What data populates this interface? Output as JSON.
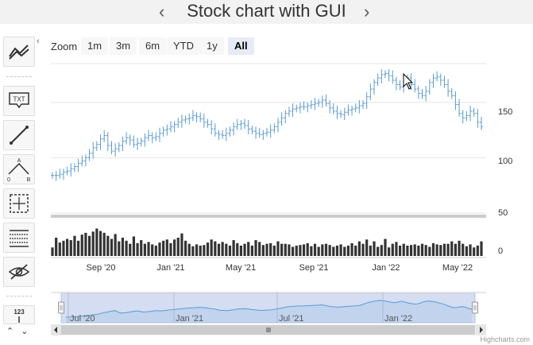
{
  "title": "Stock chart with GUI",
  "nav": {
    "prev_icon": "chevron-left-icon",
    "next_icon": "chevron-right-icon"
  },
  "zoom": {
    "label": "Zoom",
    "buttons": [
      "1m",
      "3m",
      "6m",
      "YTD",
      "1y",
      "All"
    ],
    "selected": "All"
  },
  "toolbar": {
    "tools": [
      {
        "name": "indicators-icon"
      },
      {
        "name": "text-annotation-icon",
        "label": "TXT"
      },
      {
        "name": "line-icon"
      },
      {
        "name": "elliott-wave-icon"
      },
      {
        "name": "measure-icon"
      },
      {
        "name": "fibonacci-icon"
      },
      {
        "name": "hide-show-icon"
      },
      {
        "name": "price-indicator-icon",
        "label": "123"
      }
    ],
    "stepper": {
      "up": "^",
      "down": "v"
    }
  },
  "chart_data": [
    {
      "type": "ohlc",
      "x_labels": [
        "Sep '20",
        "Jan '21",
        "May '21",
        "Sep '21",
        "Jan '22",
        "May '22"
      ],
      "y_labels": [
        "150",
        "100"
      ],
      "ylim": [
        50,
        185
      ],
      "grid": true,
      "close_values": [
        84,
        84,
        85,
        87,
        88,
        90,
        92,
        95,
        97,
        100,
        104,
        109,
        112,
        117,
        120,
        111,
        106,
        108,
        111,
        115,
        118,
        116,
        112,
        113,
        115,
        118,
        120,
        118,
        119,
        122,
        125,
        126,
        128,
        130,
        132,
        134,
        135,
        136,
        138,
        137,
        135,
        132,
        130,
        126,
        122,
        121,
        120,
        122,
        125,
        128,
        130,
        131,
        129,
        126,
        124,
        122,
        121,
        122,
        123,
        125,
        128,
        132,
        136,
        140,
        142,
        144,
        145,
        146,
        146,
        147,
        148,
        149,
        150,
        152,
        149,
        145,
        142,
        140,
        139,
        141,
        143,
        144,
        145,
        147,
        149,
        155,
        162,
        168,
        172,
        175,
        176,
        174,
        170,
        166,
        164,
        168,
        172,
        166,
        162,
        158,
        156,
        160,
        168,
        172,
        173,
        170,
        166,
        160,
        156,
        148,
        140,
        136,
        138,
        142,
        140,
        132,
        128
      ]
    },
    {
      "type": "column",
      "y_labels": [
        "50",
        "0"
      ],
      "ylim": [
        0,
        60
      ],
      "values": [
        14,
        30,
        22,
        25,
        28,
        26,
        33,
        25,
        35,
        38,
        33,
        40,
        45,
        41,
        38,
        33,
        28,
        36,
        24,
        30,
        25,
        20,
        32,
        21,
        26,
        20,
        23,
        19,
        17,
        22,
        25,
        27,
        21,
        27,
        30,
        37,
        25,
        20,
        16,
        19,
        17,
        18,
        22,
        27,
        24,
        20,
        23,
        20,
        17,
        26,
        21,
        17,
        20,
        23,
        17,
        26,
        23,
        18,
        20,
        21,
        17,
        24,
        20,
        20,
        19,
        15,
        17,
        18,
        19,
        21,
        16,
        20,
        15,
        19,
        20,
        18,
        15,
        17,
        19,
        15,
        17,
        21,
        17,
        24,
        20,
        27,
        17,
        24,
        15,
        18,
        28,
        14,
        20,
        23,
        17,
        20,
        17,
        18,
        19,
        17,
        20,
        18,
        15,
        21,
        19,
        18,
        20,
        20,
        24,
        20,
        25,
        20,
        16,
        19,
        14,
        17,
        24
      ]
    },
    {
      "type": "area",
      "x_labels": [
        "Jul '20",
        "Jan '21",
        "Jul '21",
        "Jan '22"
      ]
    }
  ],
  "navigator": {
    "scrollbar_left_icon": "arrow-left-icon",
    "scrollbar_right_icon": "arrow-right-icon"
  },
  "credits": "Highcharts.com",
  "colors": {
    "series": "#5a9bd5",
    "volume": "#333333",
    "navigator_mask": "#c9d4ee",
    "grid": "#e6e6e6",
    "separator": "#cccccc"
  }
}
